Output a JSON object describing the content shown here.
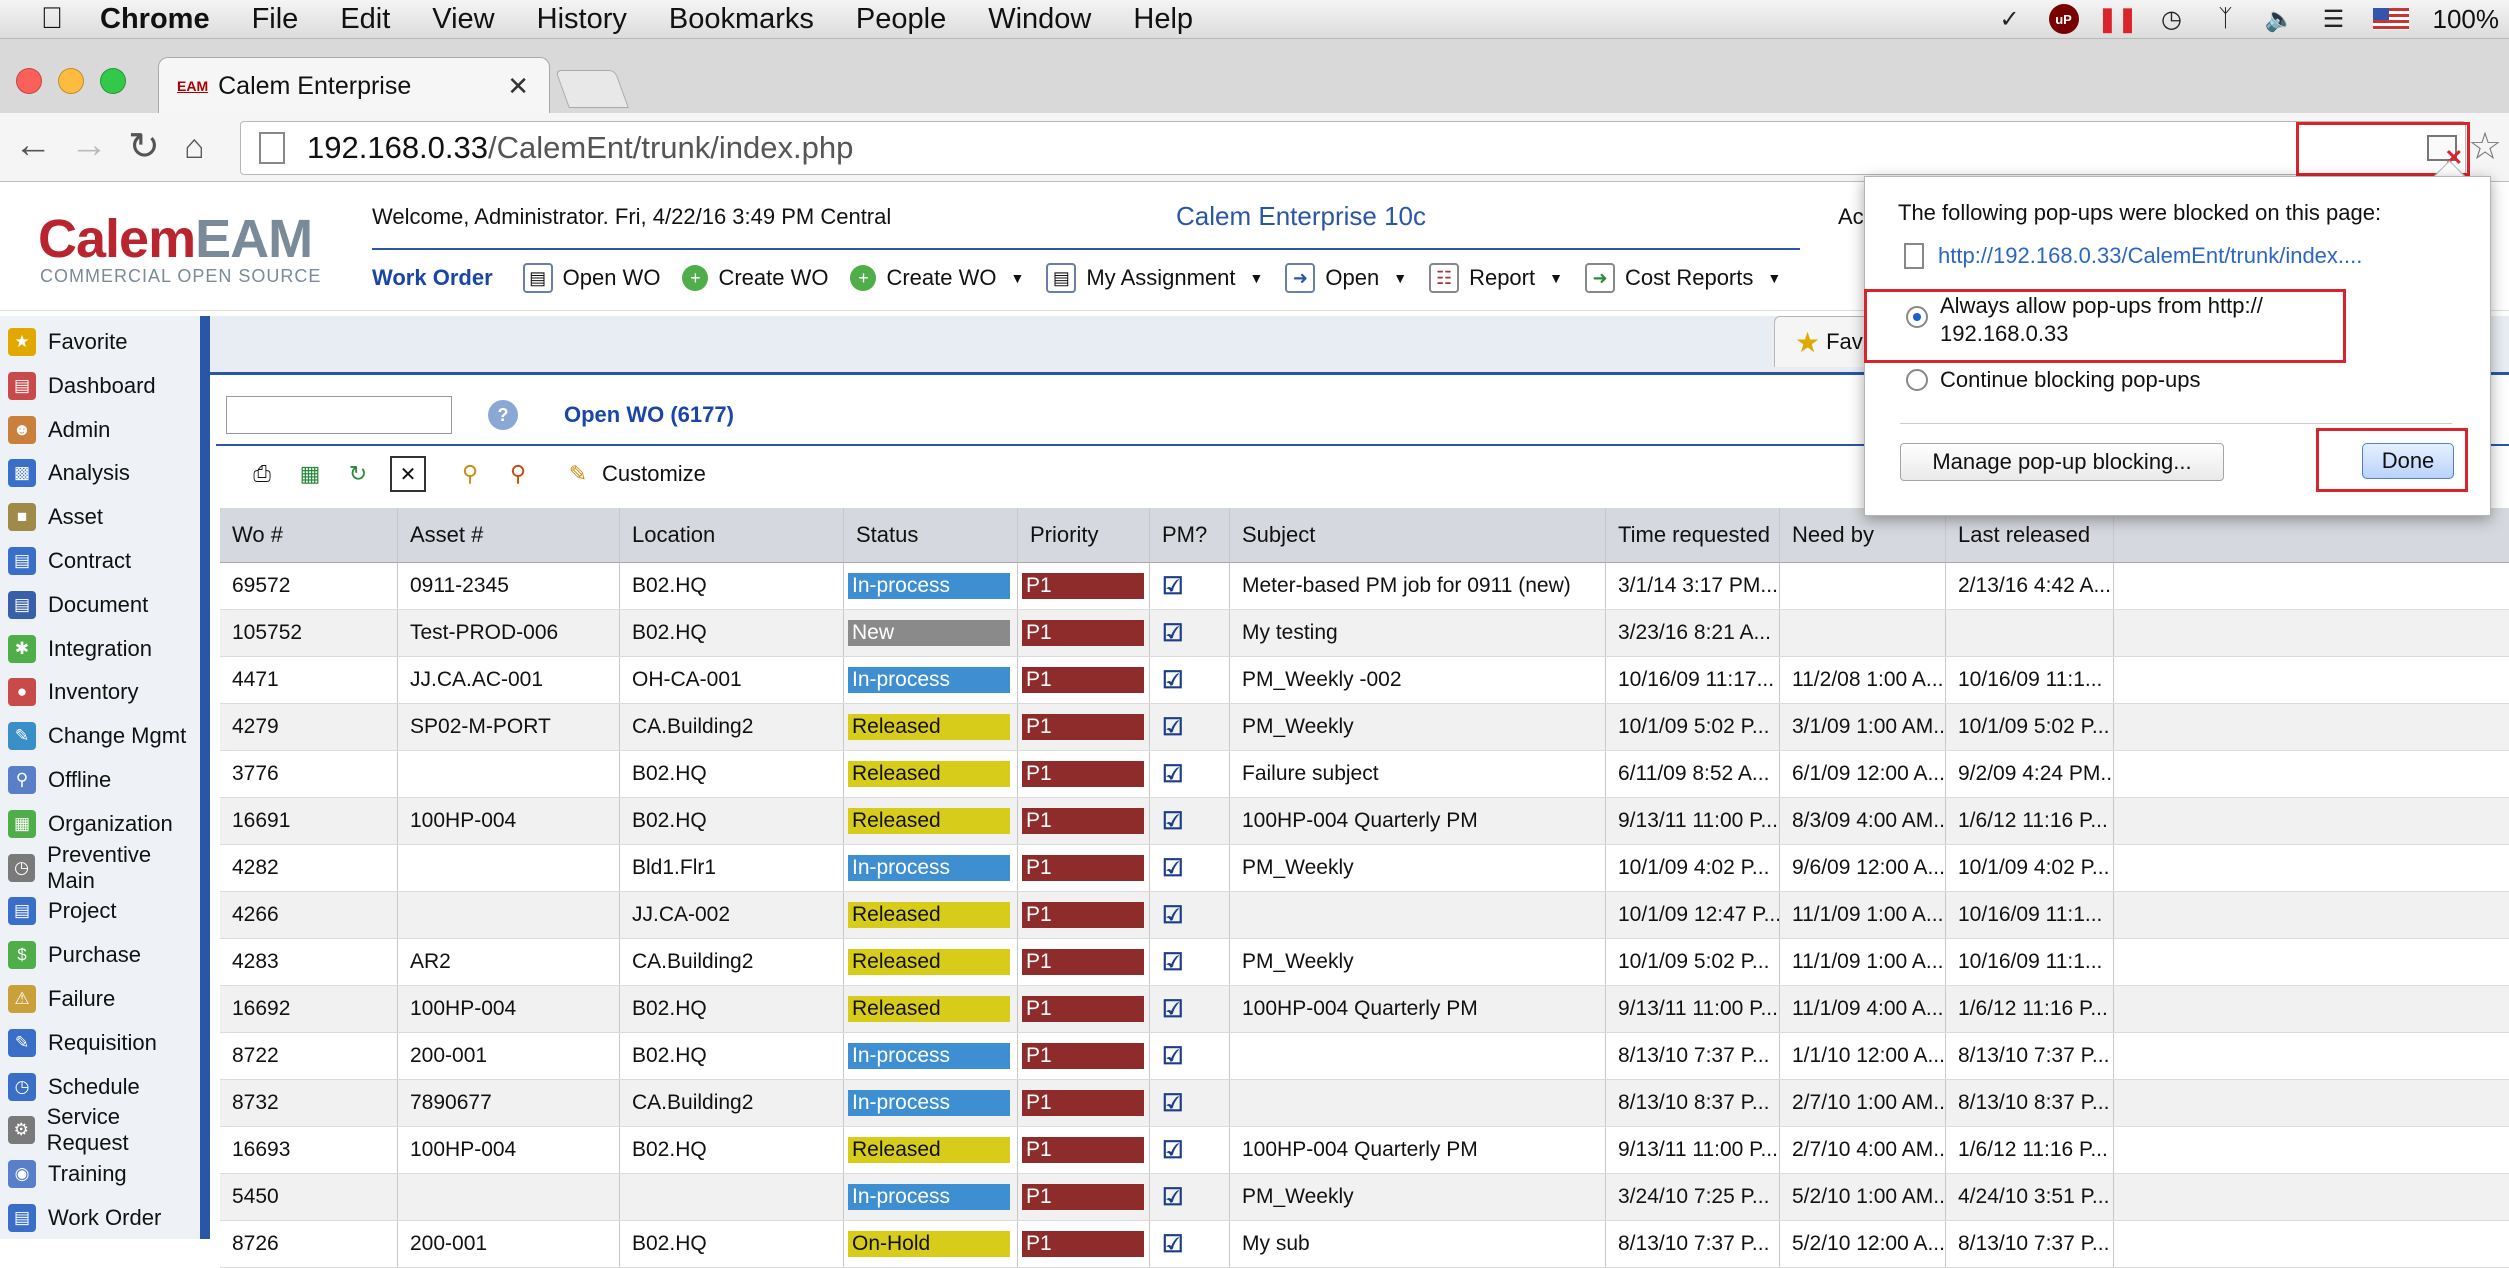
{
  "menubar": {
    "app": "Chrome",
    "items": [
      "File",
      "Edit",
      "View",
      "History",
      "Bookmarks",
      "People",
      "Window",
      "Help"
    ],
    "ublock": "uP",
    "battery": "100%"
  },
  "browser": {
    "tab_title": "Calem Enterprise",
    "tab_favicon": "EAM",
    "url_host": "192.168.0.33",
    "url_path": "/CalemEnt/trunk/index.php"
  },
  "app": {
    "logo_brand": "Calem",
    "logo_eam": "EAM",
    "logo_sub": "COMMERCIAL OPEN SOURCE",
    "welcome": "Welcome, Administrator. Fri, 4/22/16 3:49 PM Central",
    "product": "Calem Enterprise 10c",
    "right_clip": "Ac",
    "menu": {
      "module": "Work Order",
      "items": [
        "Open WO",
        "Create WO",
        "Create WO",
        "My Assignment",
        "Open",
        "Report",
        "Cost Reports"
      ]
    }
  },
  "sidebar": {
    "items": [
      "Favorite",
      "Dashboard",
      "Admin",
      "Analysis",
      "Asset",
      "Contract",
      "Document",
      "Integration",
      "Inventory",
      "Change Mgmt",
      "Offline",
      "Organization",
      "Preventive Main",
      "Project",
      "Purchase",
      "Failure",
      "Requisition",
      "Schedule",
      "Service Request",
      "Training",
      "Work Order"
    ]
  },
  "main": {
    "fav_tab": "Fav",
    "list_title": "Open WO (6177)",
    "customize": "Customize"
  },
  "grid": {
    "headers": [
      "Wo #",
      "Asset #",
      "Location",
      "Status",
      "Priority",
      "PM?",
      "Subject",
      "Time requested",
      "Need by",
      "Last released"
    ],
    "rows": [
      [
        "69572",
        "0911-2345",
        "B02.HQ",
        "In-process",
        "P1",
        "Meter-based PM job for 0911 (new)",
        "3/1/14 3:17 PM...",
        "",
        "2/13/16 4:42 A..."
      ],
      [
        "105752",
        "Test-PROD-006",
        "B02.HQ",
        "New",
        "P1",
        "My testing",
        "3/23/16 8:21 A...",
        "",
        ""
      ],
      [
        "4471",
        "JJ.CA.AC-001",
        "OH-CA-001",
        "In-process",
        "P1",
        "PM_Weekly -002",
        "10/16/09 11:17...",
        "11/2/08 1:00 A...",
        "10/16/09 11:1..."
      ],
      [
        "4279",
        "SP02-M-PORT",
        "CA.Building2",
        "Released",
        "P1",
        "PM_Weekly",
        "10/1/09 5:02 P...",
        "3/1/09 1:00 AM...",
        "10/1/09 5:02 P..."
      ],
      [
        "3776",
        "",
        "B02.HQ",
        "Released",
        "P1",
        "Failure subject",
        "6/11/09 8:52 A...",
        "6/1/09 12:00 A...",
        "9/2/09 4:24 PM..."
      ],
      [
        "16691",
        "100HP-004",
        "B02.HQ",
        "Released",
        "P1",
        "100HP-004 Quarterly PM",
        "9/13/11 11:00 P...",
        "8/3/09 4:00 AM...",
        "1/6/12 11:16 P..."
      ],
      [
        "4282",
        "",
        "Bld1.Flr1",
        "In-process",
        "P1",
        "PM_Weekly",
        "10/1/09 4:02 P...",
        "9/6/09 12:00 A...",
        "10/1/09 4:02 P..."
      ],
      [
        "4266",
        "",
        "JJ.CA-002",
        "Released",
        "P1",
        "",
        "10/1/09 12:47 P...",
        "11/1/09 1:00 A...",
        "10/16/09 11:1..."
      ],
      [
        "4283",
        "AR2",
        "CA.Building2",
        "Released",
        "P1",
        "PM_Weekly",
        "10/1/09 5:02 P...",
        "11/1/09 1:00 A...",
        "10/16/09 11:1..."
      ],
      [
        "16692",
        "100HP-004",
        "B02.HQ",
        "Released",
        "P1",
        "100HP-004 Quarterly PM",
        "9/13/11 11:00 P...",
        "11/1/09 4:00 A...",
        "1/6/12 11:16 P..."
      ],
      [
        "8722",
        "200-001",
        "B02.HQ",
        "In-process",
        "P1",
        "",
        "8/13/10 7:37 P...",
        "1/1/10 12:00 A...",
        "8/13/10 7:37 P..."
      ],
      [
        "8732",
        "7890677",
        "CA.Building2",
        "In-process",
        "P1",
        "",
        "8/13/10 8:37 P...",
        "2/7/10 1:00 AM...",
        "8/13/10 8:37 P..."
      ],
      [
        "16693",
        "100HP-004",
        "B02.HQ",
        "Released",
        "P1",
        "100HP-004 Quarterly PM",
        "9/13/11 11:00 P...",
        "2/7/10 4:00 AM...",
        "1/6/12 11:16 P..."
      ],
      [
        "5450",
        "",
        "",
        "In-process",
        "P1",
        "PM_Weekly",
        "3/24/10 7:25 P...",
        "5/2/10 1:00 AM...",
        "4/24/10 3:51 P..."
      ],
      [
        "8726",
        "200-001",
        "B02.HQ",
        "On-Hold",
        "P1",
        "My sub",
        "8/13/10 7:37 P...",
        "5/2/10 12:00 A...",
        "8/13/10 7:37 P..."
      ]
    ]
  },
  "status_colors": {
    "In-process": "#3d8fd1",
    "New": "#8a8a8a",
    "Released": "#d8cc1a",
    "On-Hold": "#d8cc1a"
  },
  "popup": {
    "title": "The following pop-ups were blocked on this page:",
    "link": "http://192.168.0.33/CalemEnt/trunk/index....",
    "allow_line1": "Always allow pop-ups from http://",
    "allow_line2": "192.168.0.33",
    "block": "Continue blocking pop-ups",
    "manage": "Manage pop-up blocking...",
    "done": "Done"
  }
}
